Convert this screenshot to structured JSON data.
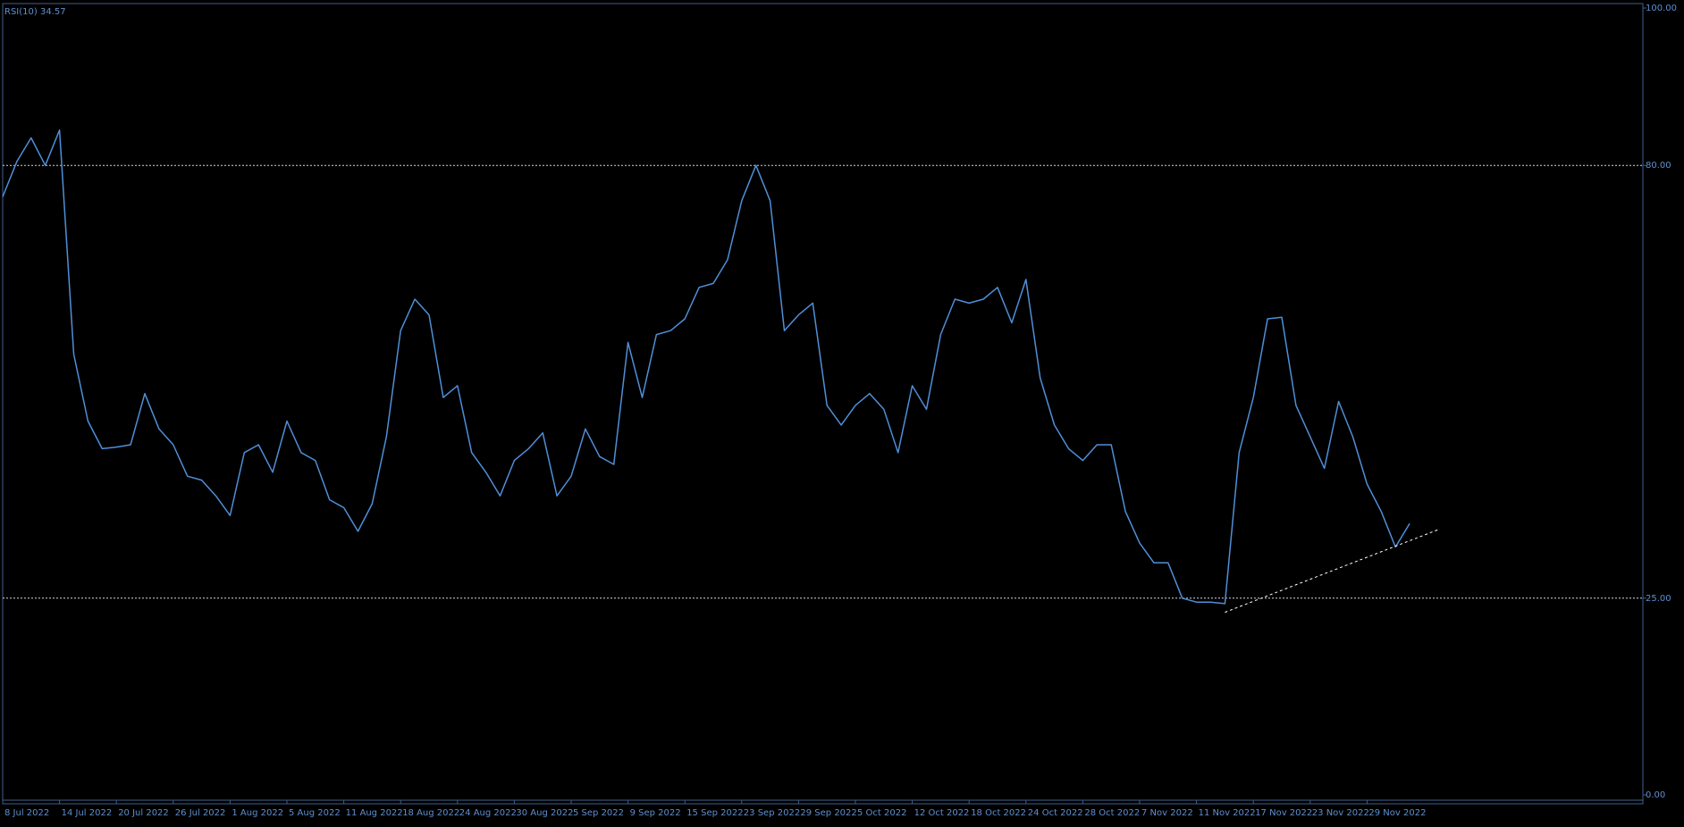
{
  "indicator_label": "RSI(10) 34.57",
  "colors": {
    "background": "#000000",
    "frame": "#3f5f8f",
    "line": "#4f8fd8",
    "text": "#5f8fcf",
    "level_line": "#cfd8e8",
    "trendline": "#ffffff"
  },
  "chart_data": {
    "type": "line",
    "title": "RSI(10) 34.57",
    "ylim": [
      0,
      100
    ],
    "y_tick_labels": [
      "100.00",
      "80.00",
      "25.00",
      "0.00"
    ],
    "y_ticks": [
      100,
      80,
      25,
      0
    ],
    "levels": [
      80,
      25
    ],
    "x_tick_labels": [
      "8 Jul 2022",
      "14 Jul 2022",
      "20 Jul 2022",
      "26 Jul 2022",
      "1 Aug 2022",
      "5 Aug 2022",
      "11 Aug 2022",
      "18 Aug 2022",
      "24 Aug 2022",
      "30 Aug 2022",
      "5 Sep 2022",
      "9 Sep 2022",
      "15 Sep 2022",
      "23 Sep 2022",
      "29 Sep 2022",
      "5 Oct 2022",
      "12 Oct 2022",
      "18 Oct 2022",
      "24 Oct 2022",
      "28 Oct 2022",
      "7 Nov 2022",
      "11 Nov 2022",
      "17 Nov 2022",
      "23 Nov 2022",
      "29 Nov 2022"
    ],
    "x_tick_bar_index": [
      0,
      4,
      8,
      12,
      16,
      20,
      24,
      28,
      32,
      36,
      40,
      44,
      48,
      52,
      56,
      60,
      64,
      68,
      72,
      76,
      80,
      84,
      88,
      92,
      96
    ],
    "grid": false,
    "series": [
      {
        "values": [
          76.0,
          80.5,
          83.5,
          80.0,
          84.5,
          56.0,
          47.5,
          44.0,
          44.2,
          44.5,
          51.0,
          46.5,
          44.5,
          40.5,
          40.0,
          38.0,
          35.5,
          43.5,
          44.5,
          41.0,
          47.5,
          43.5,
          42.5,
          37.5,
          36.5,
          33.5,
          37.0,
          45.5,
          59.0,
          63.0,
          61.0,
          50.5,
          52.0,
          43.5,
          41.0,
          38.0,
          42.5,
          44.0,
          46.0,
          38.0,
          40.5,
          46.5,
          43.0,
          42.0,
          57.5,
          50.5,
          58.5,
          59.0,
          60.5,
          64.5,
          65.0,
          68.0,
          75.5,
          80.0,
          75.5,
          59.0,
          61.0,
          62.5,
          49.5,
          47.0,
          49.5,
          51.0,
          49.0,
          43.5,
          52.0,
          49.0,
          58.5,
          63.0,
          62.5,
          63.0,
          64.5,
          60.0,
          65.5,
          53.0,
          47.0,
          44.0,
          42.5,
          44.5,
          44.5,
          36.0,
          32.0,
          29.5,
          29.5,
          25.0,
          24.5,
          24.5,
          24.3,
          43.5,
          50.5,
          60.5,
          60.7,
          49.5,
          45.5,
          41.5,
          50.0,
          45.5,
          39.5,
          36.0,
          31.5,
          34.5
        ]
      }
    ],
    "trendline": {
      "x_index": [
        86,
        101
      ],
      "y": [
        23.2,
        33.7
      ]
    }
  }
}
